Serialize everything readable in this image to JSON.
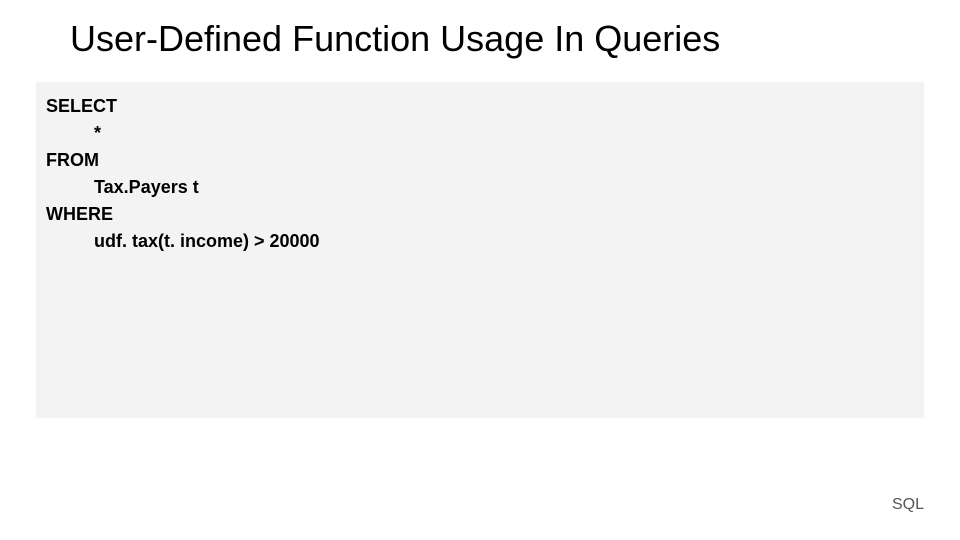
{
  "title": "User-Defined Function Usage In Queries",
  "code": {
    "kw_select": "SELECT",
    "select_list": "*",
    "kw_from": "FROM",
    "from_table": "Tax.Payers t",
    "kw_where": "WHERE",
    "where_cond": "udf. tax(t. income) > 20000"
  },
  "badge": "SQL"
}
